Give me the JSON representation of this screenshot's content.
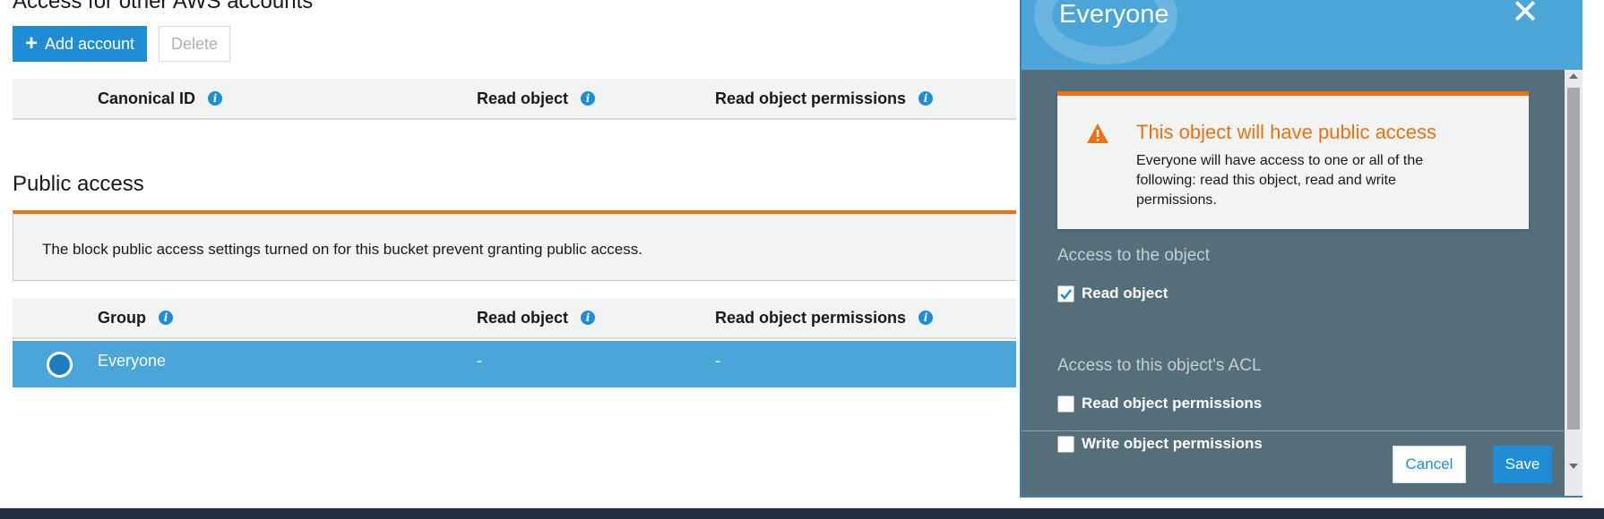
{
  "main": {
    "aws_section_title": "Access for other AWS accounts",
    "add_account_label": "Add account",
    "delete_label": "Delete",
    "aws_table_headers": [
      "Canonical ID",
      "Read object",
      "Read object permissions"
    ],
    "public_section_title": "Public access",
    "public_banner_text": "The block public access settings turned on for this bucket prevent granting public access.",
    "public_table_headers": [
      "Group",
      "Read object",
      "Read object permissions"
    ],
    "public_rows": [
      {
        "group": "Everyone",
        "read_object": "-",
        "read_object_permissions": "-",
        "selected": true
      }
    ]
  },
  "modal": {
    "title": "Everyone",
    "warning_title": "This object will have public access",
    "warning_text": "Everyone will have access to one or all of the following: read this object, read and write permissions.",
    "object_access_label": "Access to the object",
    "acl_access_label": "Access to this object's ACL",
    "checkboxes": [
      {
        "label": "Read object",
        "checked": true
      },
      {
        "label": "Read object permissions",
        "checked": false
      },
      {
        "label": "Write object permissions",
        "checked": false
      }
    ],
    "cancel_label": "Cancel",
    "save_label": "Save"
  },
  "colors": {
    "accent": "#1f8dd6",
    "warning": "#ec7211",
    "modal_bg": "#546e7a",
    "header_bg": "#4aa5d9"
  }
}
